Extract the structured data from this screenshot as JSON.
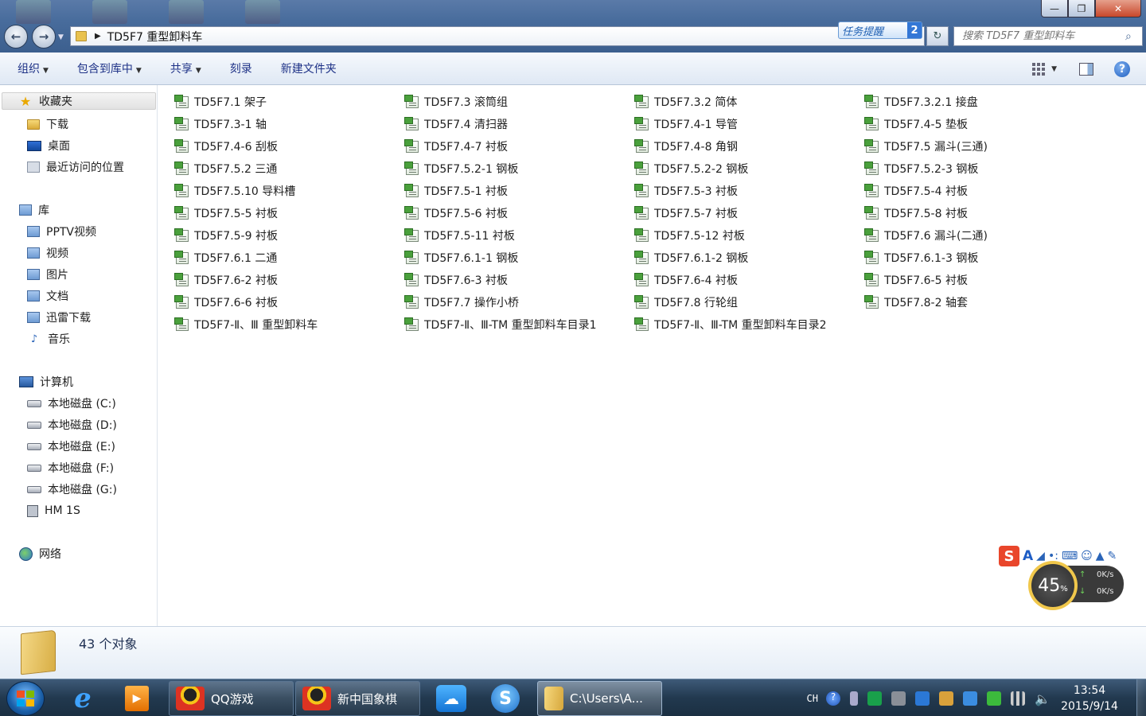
{
  "window": {
    "minimize": "—",
    "maximize": "❐",
    "close": "✕"
  },
  "address": {
    "path": "TD5F7 重型卸料车",
    "task_reminder": "任务提醒",
    "task_reminder_count": "2",
    "search_placeholder": "搜索 TD5F7 重型卸料车"
  },
  "toolbar": {
    "organize": "组织",
    "include_in_library": "包含到库中",
    "share": "共享",
    "burn": "刻录",
    "new_folder": "新建文件夹"
  },
  "sidebar": {
    "favorites": "收藏夹",
    "downloads": "下载",
    "desktop": "桌面",
    "recent": "最近访问的位置",
    "libraries": "库",
    "pptv": "PPTV视频",
    "videos": "视频",
    "pictures": "图片",
    "documents": "文档",
    "xunlei": "迅雷下载",
    "music": "音乐",
    "computer": "计算机",
    "drive_c": "本地磁盘 (C:)",
    "drive_d": "本地磁盘 (D:)",
    "drive_e": "本地磁盘 (E:)",
    "drive_f": "本地磁盘 (F:)",
    "drive_g": "本地磁盘 (G:)",
    "hm1s": "HM 1S",
    "network": "网络"
  },
  "files": [
    "TD5F7.1 架子",
    "TD5F7.3 滚筒组",
    "TD5F7.3.2 简体",
    "TD5F7.3.2.1 接盘",
    "TD5F7.3-1 轴",
    "TD5F7.4 清扫器",
    "TD5F7.4-1 导管",
    "TD5F7.4-5 垫板",
    "TD5F7.4-6 刮板",
    "TD5F7.4-7 衬板",
    "TD5F7.4-8 角钢",
    "TD5F7.5 漏斗(三通)",
    "TD5F7.5.2 三通",
    "TD5F7.5.2-1 钢板",
    "TD5F7.5.2-2 钢板",
    "TD5F7.5.2-3 钢板",
    "TD5F7.5.10 导料槽",
    "TD5F7.5-1 衬板",
    "TD5F7.5-3 衬板",
    "TD5F7.5-4 衬板",
    "TD5F7.5-5 衬板",
    "TD5F7.5-6 衬板",
    "TD5F7.5-7 衬板",
    "TD5F7.5-8 衬板",
    "TD5F7.5-9 衬板",
    "TD5F7.5-11 衬板",
    "TD5F7.5-12 衬板",
    "TD5F7.6 漏斗(二通)",
    "TD5F7.6.1 二通",
    "TD5F7.6.1-1 钢板",
    "TD5F7.6.1-2 钢板",
    "TD5F7.6.1-3 钢板",
    "TD5F7.6-2 衬板",
    "TD5F7.6-3 衬板",
    "TD5F7.6-4 衬板",
    "TD5F7.6-5 衬板",
    "TD5F7.6-6 衬板",
    "TD5F7.7 操作小桥",
    "TD5F7.8 行轮组",
    "TD5F7.8-2 轴套",
    "TD5F7-Ⅱ、Ⅲ 重型卸料车",
    "TD5F7-Ⅱ、Ⅲ-TM 重型卸料车目录1",
    "TD5F7-Ⅱ、Ⅲ-TM 重型卸料车目录2"
  ],
  "details": {
    "count": "43 个对象"
  },
  "widget": {
    "percent": "45",
    "percent_sign": "%",
    "up": "0K/s",
    "down": "0K/s",
    "ime_logo": "S",
    "ime_a": "A"
  },
  "taskbar": {
    "qq_games": "QQ游戏",
    "chess": "新中国象棋",
    "explorer": "C:\\Users\\A...",
    "lang": "CH",
    "time": "13:54",
    "date": "2015/9/14"
  }
}
